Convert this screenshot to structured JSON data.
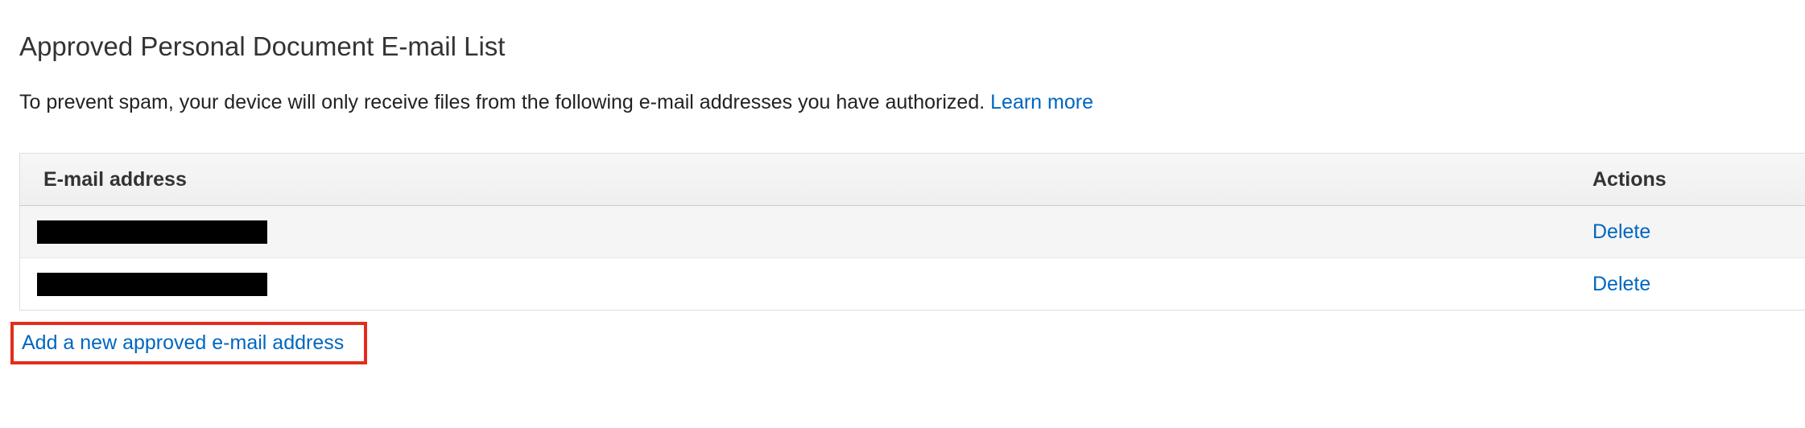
{
  "page": {
    "title": "Approved Personal Document E-mail List",
    "description": "To prevent spam, your device will only receive files from the following e-mail addresses you have authorized.",
    "learn_more": "Learn more"
  },
  "table": {
    "columns": {
      "email": "E-mail address",
      "actions": "Actions"
    },
    "rows": [
      {
        "email": "",
        "action": "Delete"
      },
      {
        "email": "",
        "action": "Delete"
      }
    ]
  },
  "add_link": "Add a new approved e-mail address",
  "colors": {
    "link": "#0066c0",
    "highlight_box": "#e32d1c",
    "redaction": "#000000"
  }
}
